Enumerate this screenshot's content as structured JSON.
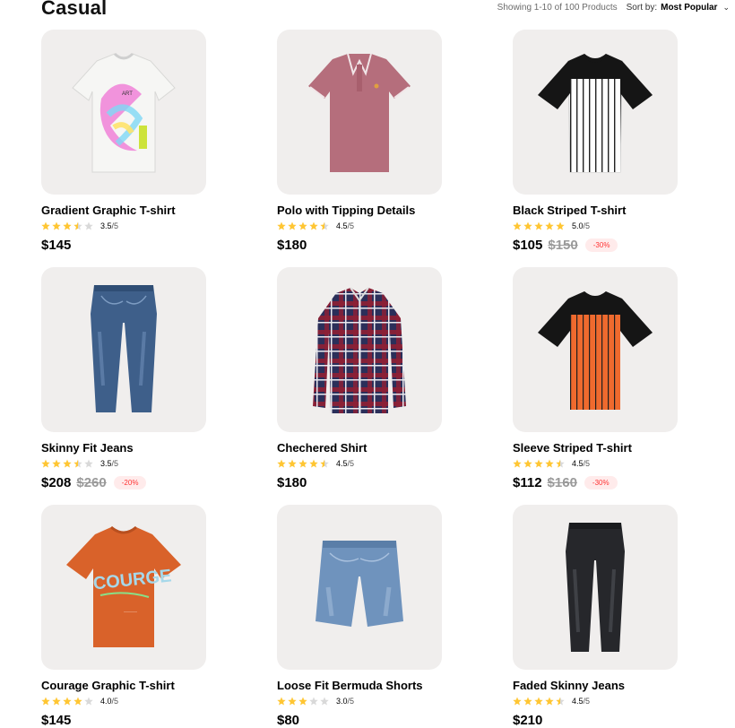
{
  "header": {
    "title": "Casual",
    "showing_text": "Showing 1-10 of 100 Products",
    "sort_label": "Sort by:",
    "sort_value": "Most Popular"
  },
  "colors": {
    "star": "#ffc633",
    "star_empty": "#d9d9d9",
    "discount_text": "#ff3333",
    "discount_bg": "#ffebeb",
    "card_bg": "#f0eeed"
  },
  "products": [
    {
      "name": "Gradient Graphic T-shirt",
      "rating": 3.5,
      "rating_text": "3.5",
      "rating_max": "/5",
      "price": "$145",
      "old_price": "",
      "discount": "",
      "image": "white-graphic-tshirt-icon"
    },
    {
      "name": "Polo with Tipping Details",
      "rating": 4.5,
      "rating_text": "4.5",
      "rating_max": "/5",
      "price": "$180",
      "old_price": "",
      "discount": "",
      "image": "polo-shirt-icon"
    },
    {
      "name": "Black Striped T-shirt",
      "rating": 5.0,
      "rating_text": "5.0",
      "rating_max": "/5",
      "price": "$105",
      "old_price": "$150",
      "discount": "-30%",
      "image": "striped-raglan-tshirt-icon"
    },
    {
      "name": "Skinny Fit Jeans",
      "rating": 3.5,
      "rating_text": "3.5",
      "rating_max": "/5",
      "price": "$208",
      "old_price": "$260",
      "discount": "-20%",
      "image": "jeans-icon"
    },
    {
      "name": "Chechered Shirt",
      "rating": 4.5,
      "rating_text": "4.5",
      "rating_max": "/5",
      "price": "$180",
      "old_price": "",
      "discount": "",
      "image": "plaid-shirt-icon"
    },
    {
      "name": "Sleeve Striped T-shirt",
      "rating": 4.5,
      "rating_text": "4.5",
      "rating_max": "/5",
      "price": "$112",
      "old_price": "$160",
      "discount": "-30%",
      "image": "orange-raglan-tshirt-icon"
    },
    {
      "name": "Courage Graphic T-shirt",
      "rating": 4.0,
      "rating_text": "4.0",
      "rating_max": "/5",
      "price": "$145",
      "old_price": "",
      "discount": "",
      "image": "orange-graphic-tshirt-icon"
    },
    {
      "name": "Loose Fit Bermuda Shorts",
      "rating": 3.0,
      "rating_text": "3.0",
      "rating_max": "/5",
      "price": "$80",
      "old_price": "",
      "discount": "",
      "image": "denim-shorts-icon"
    },
    {
      "name": "Faded Skinny Jeans",
      "rating": 4.5,
      "rating_text": "4.5",
      "rating_max": "/5",
      "price": "$210",
      "old_price": "",
      "discount": "",
      "image": "black-jeans-icon"
    }
  ]
}
